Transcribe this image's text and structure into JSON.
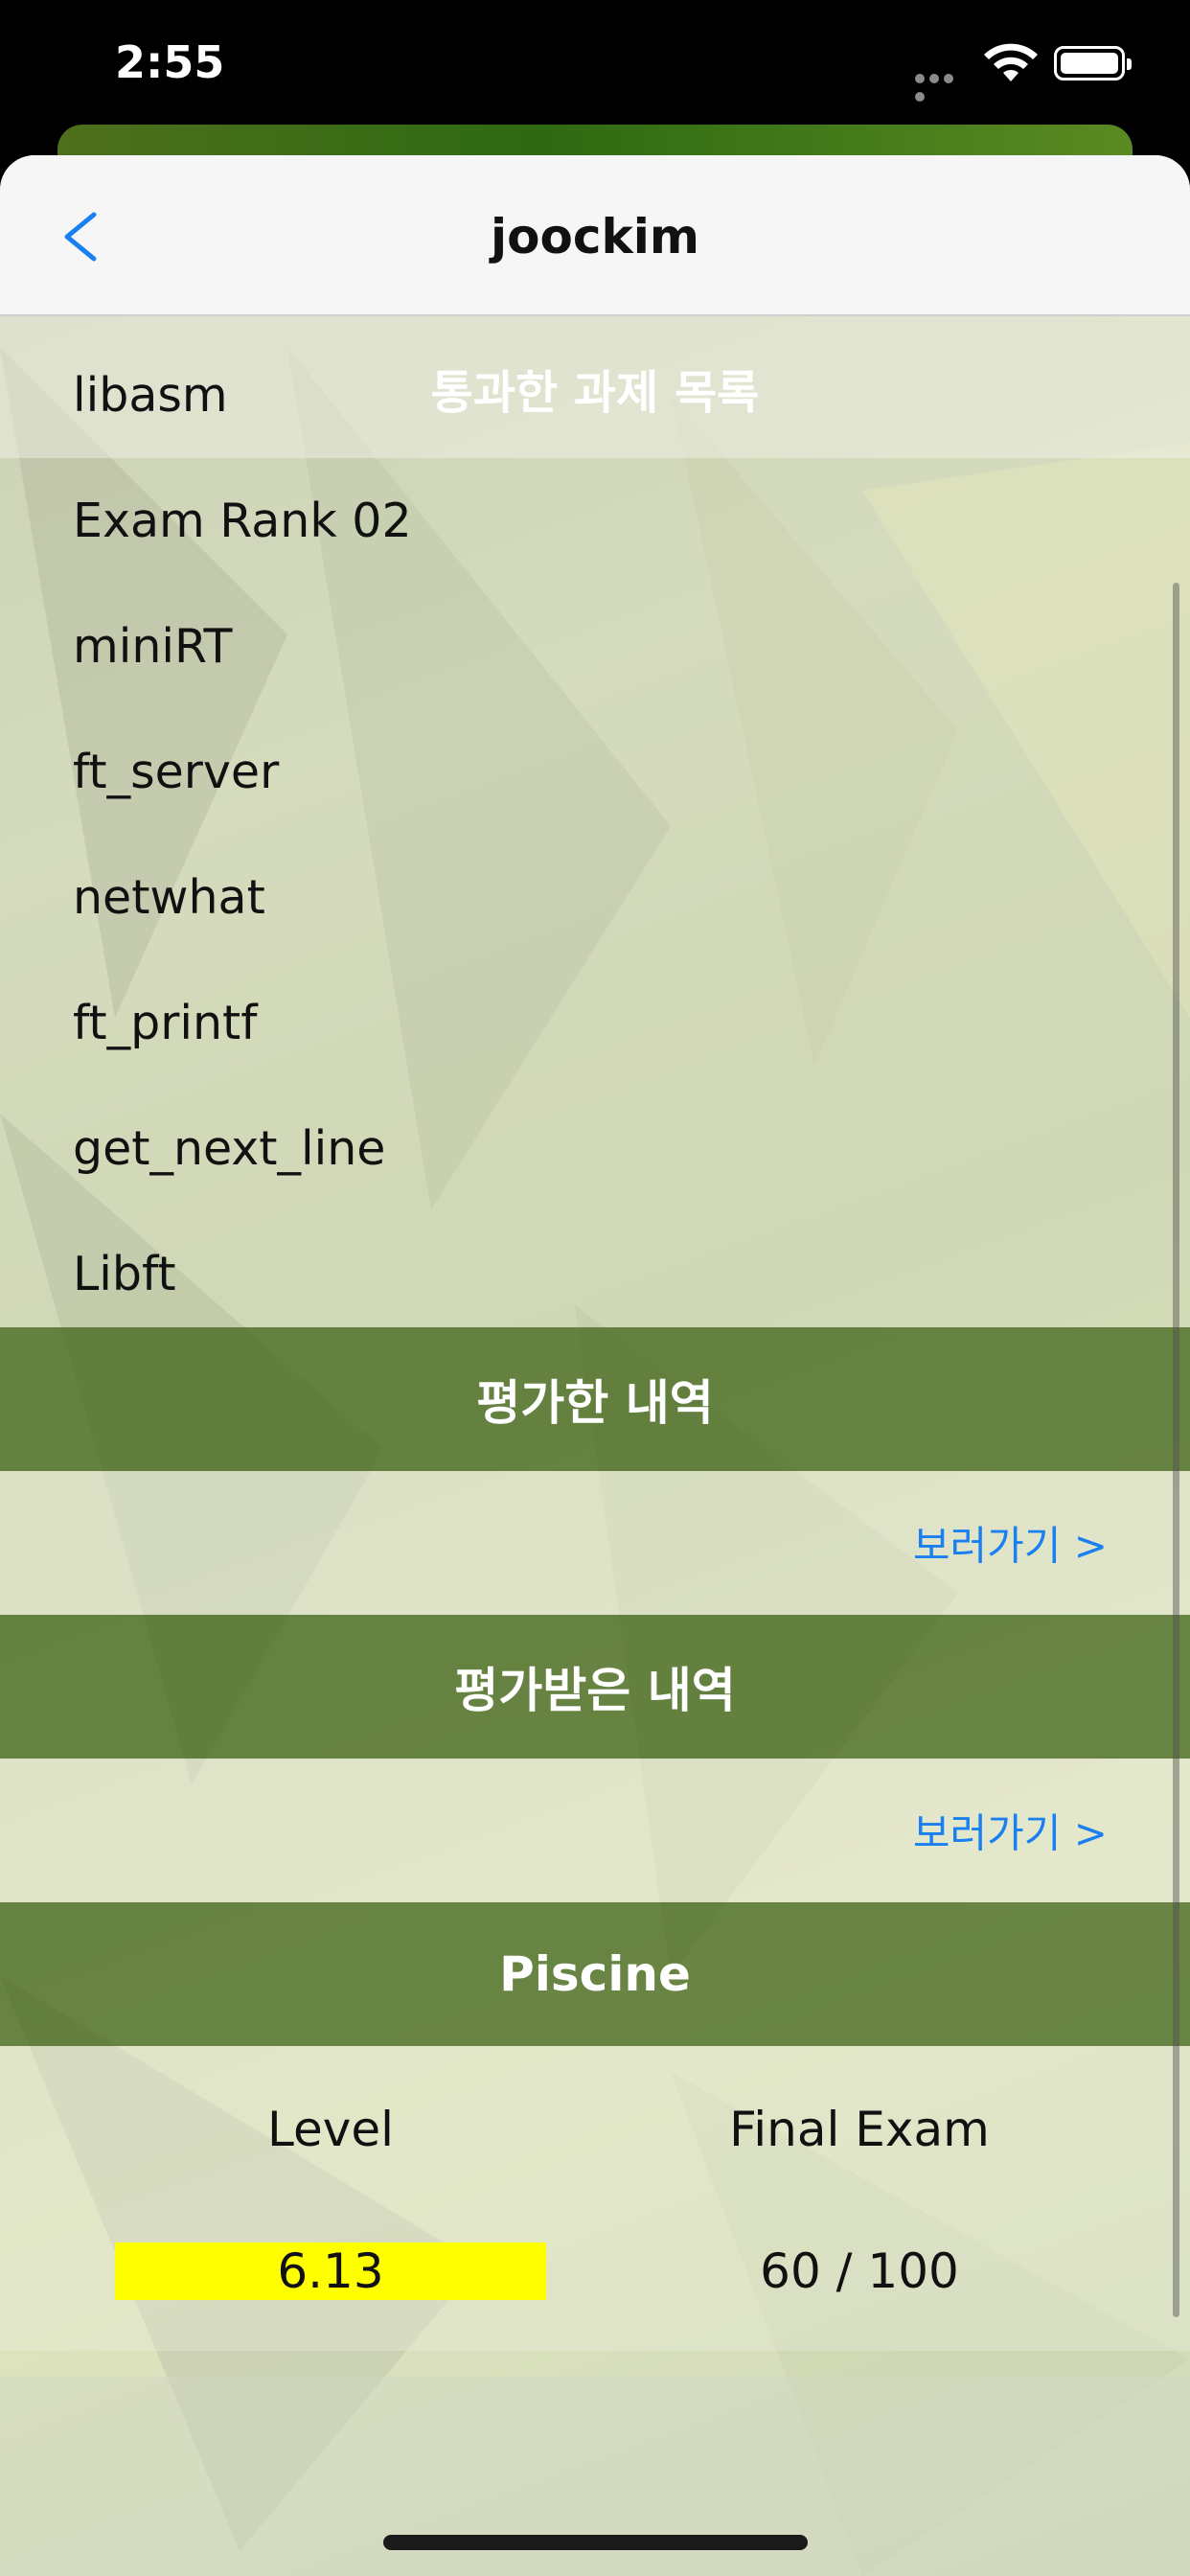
{
  "status_bar": {
    "time": "2:55"
  },
  "nav": {
    "title": "joockim",
    "back_label": "<"
  },
  "projects": {
    "title": "통과한 과제 목록",
    "items": [
      "libasm",
      "Exam Rank 02",
      "miniRT",
      "ft_server",
      "netwhat",
      "ft_printf",
      "get_next_line",
      "Libft"
    ]
  },
  "evaluated": {
    "title": "평가한 내역",
    "link": "보러가기 >"
  },
  "evaluations_received": {
    "title": "평가받은 내역",
    "link": "보러가기 >"
  },
  "piscine": {
    "title": "Piscine",
    "level_label": "Level",
    "level_value": "6.13",
    "level_fill": 1.0,
    "exam_label": "Final Exam",
    "exam_value": "60 / 100"
  },
  "colors": {
    "accent": "#1a7ff0",
    "level_bar": "#ffff00",
    "section_header": "#4b6f1c"
  }
}
